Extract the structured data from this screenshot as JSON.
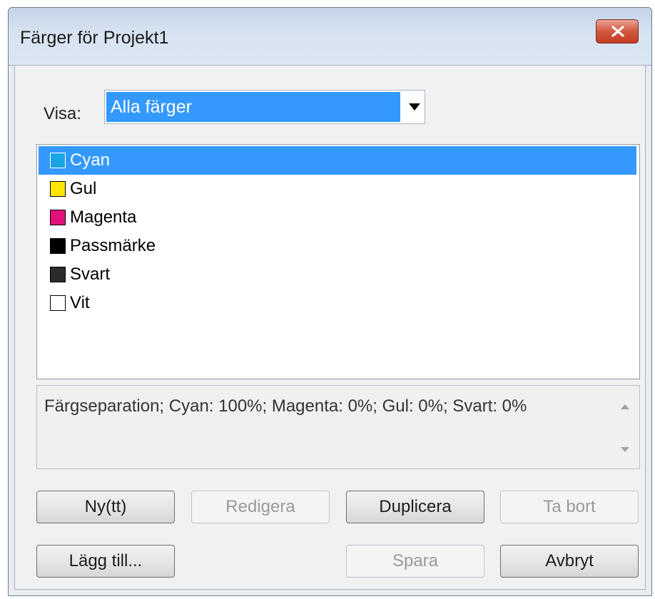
{
  "window": {
    "title": "Färger för Projekt1"
  },
  "visa": {
    "label": "Visa:",
    "selected": "Alla färger"
  },
  "colors": [
    {
      "label": "Cyan",
      "swatch": "#1aa6e4",
      "selected": true
    },
    {
      "label": "Gul",
      "swatch": "#ffe600",
      "selected": false
    },
    {
      "label": "Magenta",
      "swatch": "#e0117a",
      "selected": false
    },
    {
      "label": "Passmärke",
      "swatch": "#000000",
      "selected": false
    },
    {
      "label": "Svart",
      "swatch": "#2b2b2b",
      "selected": false
    },
    {
      "label": "Vit",
      "swatch": "#ffffff",
      "selected": false
    }
  ],
  "description": {
    "text": "Färgseparation; Cyan: 100%; Magenta: 0%; Gul: 0%; Svart: 0%"
  },
  "buttons": {
    "new": "Ny(tt)",
    "edit": "Redigera",
    "duplicate": "Duplicera",
    "delete": "Ta bort",
    "append": "Lägg till...",
    "save": "Spara",
    "cancel": "Avbryt"
  },
  "icons": {
    "close": "close-icon",
    "dropdown": "chevron-down-icon"
  }
}
